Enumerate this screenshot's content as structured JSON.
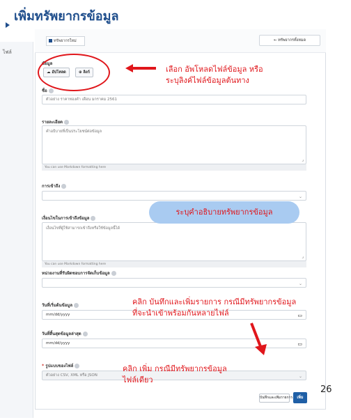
{
  "slide": {
    "title": "เพิ่มทรัพยากรข้อมูล",
    "page_number": "26"
  },
  "sidebar": {
    "label": "ไฟล์"
  },
  "top": {
    "tab_label": "ทรัพยากรใหม่",
    "back_label": "← ทรัพยากรทั้งหมด"
  },
  "form": {
    "data_label": "ข้อมูล",
    "upload_label": "อัปโหลด",
    "link_label": "ลิงก์",
    "name_label": "ชื่อ",
    "name_placeholder": "ตัวอย่าง ราคาทองคำ เดือน มกราคม 2561",
    "desc_label": "รายละเอียด",
    "desc_placeholder": "คำอธิบายที่เป็นประโยชน์ต่อข้อมูล",
    "markdown_hint": "You can use Markdown formatting here",
    "format_label": "การเข้าถึง",
    "usage_label": "เงื่อนไขในการเข้าถึงข้อมูล",
    "usage_placeholder": "เงื่อนไขที่ผู้ใช้สามารถเข้าถึงหรือใช้ข้อมูลนี้ได้",
    "unit_label": "หน่วยงานที่รับผิดชอบการจัดเก็บข้อมูล",
    "start_label": "วันที่เริ่มต้นข้อมูล",
    "date_placeholder": "mm/dd/yyyy",
    "end_label": "วันที่สิ้นสุดข้อมูลล่าสุด",
    "format_type_label": "รูปแบบของไฟล์",
    "format_type_placeholder": "ตัวอย่าง CSV, XML หรือ JSON",
    "save_add_label": "บันทึกและเพิ่มรายการ",
    "add_label": "เพิ่ม"
  },
  "annotations": {
    "upload_note_1": "เลือก อัพโหลดไฟล์ข้อมูล หรือ",
    "upload_note_2": "ระบุลิงค์ไฟล์ข้อมูลต้นทาง",
    "desc_note": "ระบุคำอธิบายทรัพยากรข้อมูล",
    "save_note_1": "คลิก บันทึกและเพิ่มรายการ กรณีมีทรัพยากรข้อมูล",
    "save_note_2": "ที่จะนำเข้าพร้อมกันหลายไฟล์",
    "add_note_1": "คลิก เพิ่ม กรณีมีทรัพยากรข้อมูล",
    "add_note_2": "ไฟล์เดียว"
  },
  "colors": {
    "accent": "#1f4e8c",
    "annotation_red": "#e0161b",
    "highlight_blue": "#a9cbf1",
    "primary_button": "#1f5fa6"
  }
}
